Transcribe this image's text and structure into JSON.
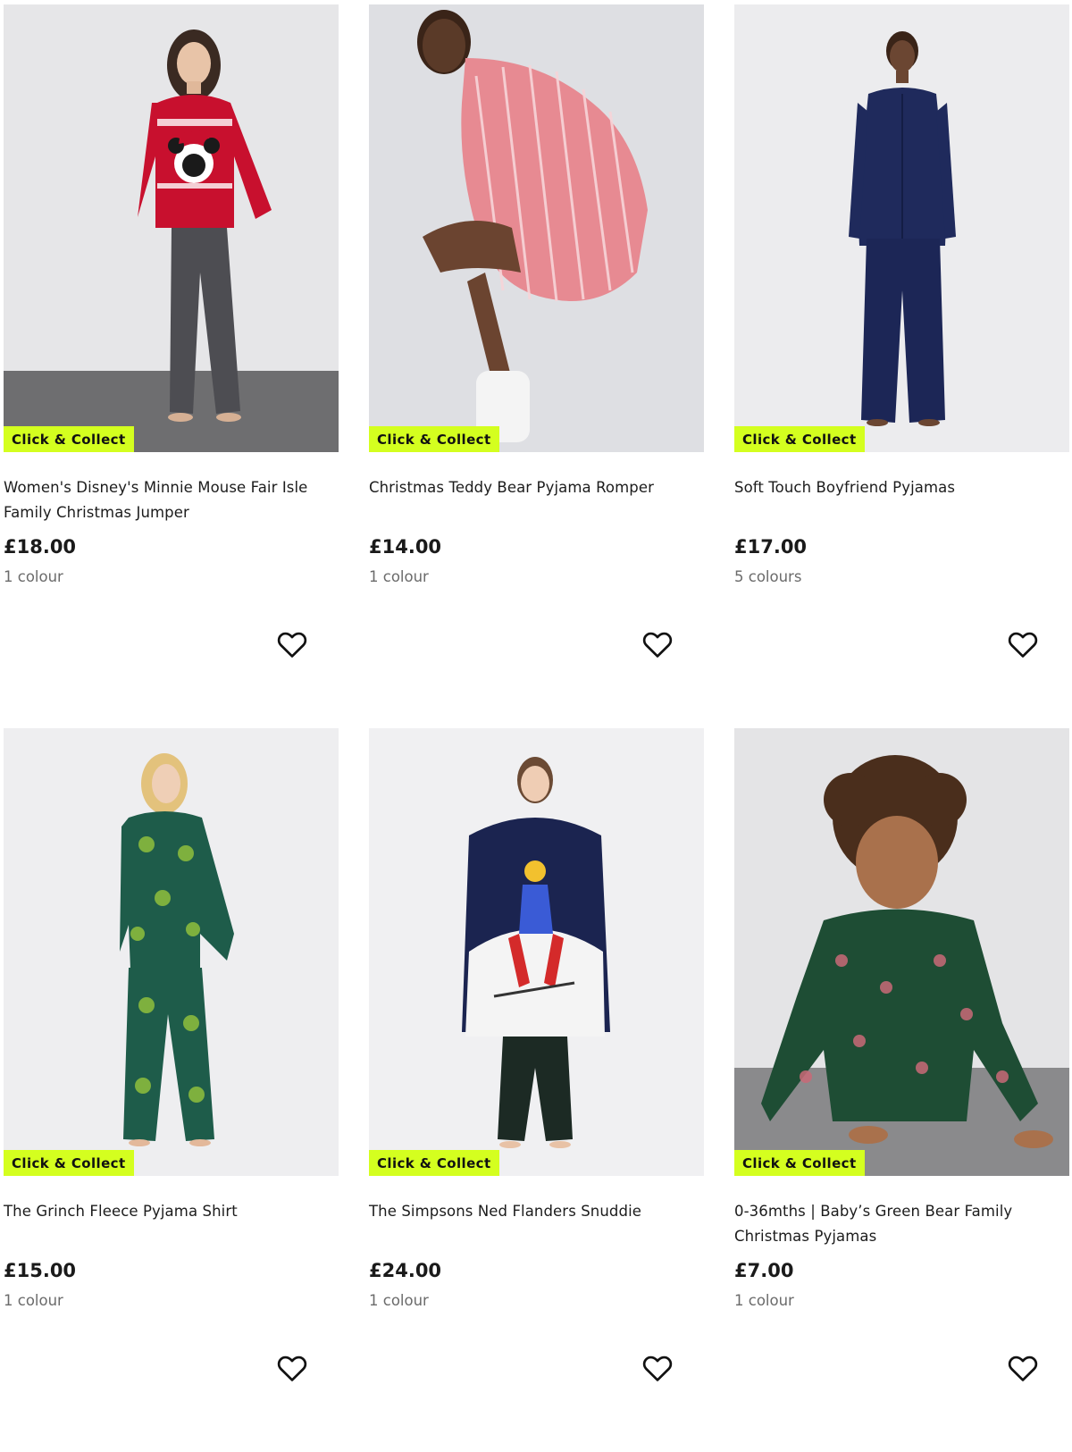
{
  "products": [
    {
      "title": "Women's Disney's Minnie Mouse Fair Isle Family Christmas Jumper",
      "price": "£18.00",
      "colours": "1 colour",
      "badge": "Click & Collect",
      "favourite_icon": "heart-outline-icon"
    },
    {
      "title": "Christmas Teddy Bear Pyjama Romper",
      "price": "£14.00",
      "colours": "1 colour",
      "badge": "Click & Collect",
      "favourite_icon": "heart-outline-icon"
    },
    {
      "title": "Soft Touch Boyfriend Pyjamas",
      "price": "£17.00",
      "colours": "5 colours",
      "badge": "Click & Collect",
      "favourite_icon": "heart-outline-icon"
    },
    {
      "title": "The Grinch Fleece Pyjama Shirt",
      "price": "£15.00",
      "colours": "1 colour",
      "badge": "Click & Collect",
      "favourite_icon": "heart-outline-icon"
    },
    {
      "title": "The Simpsons Ned Flanders Snuddie",
      "price": "£24.00",
      "colours": "1 colour",
      "badge": "Click & Collect",
      "favourite_icon": "heart-outline-icon"
    },
    {
      "title": "0-36mths | Baby’s Green Bear Family Christmas Pyjamas",
      "price": "£7.00",
      "colours": "1 colour",
      "badge": "Click & Collect",
      "favourite_icon": "heart-outline-icon"
    }
  ],
  "colors": {
    "badge_background": "#d4ff1f",
    "price_text": "#1a1a1a",
    "colours_text": "#6b6b6b"
  }
}
